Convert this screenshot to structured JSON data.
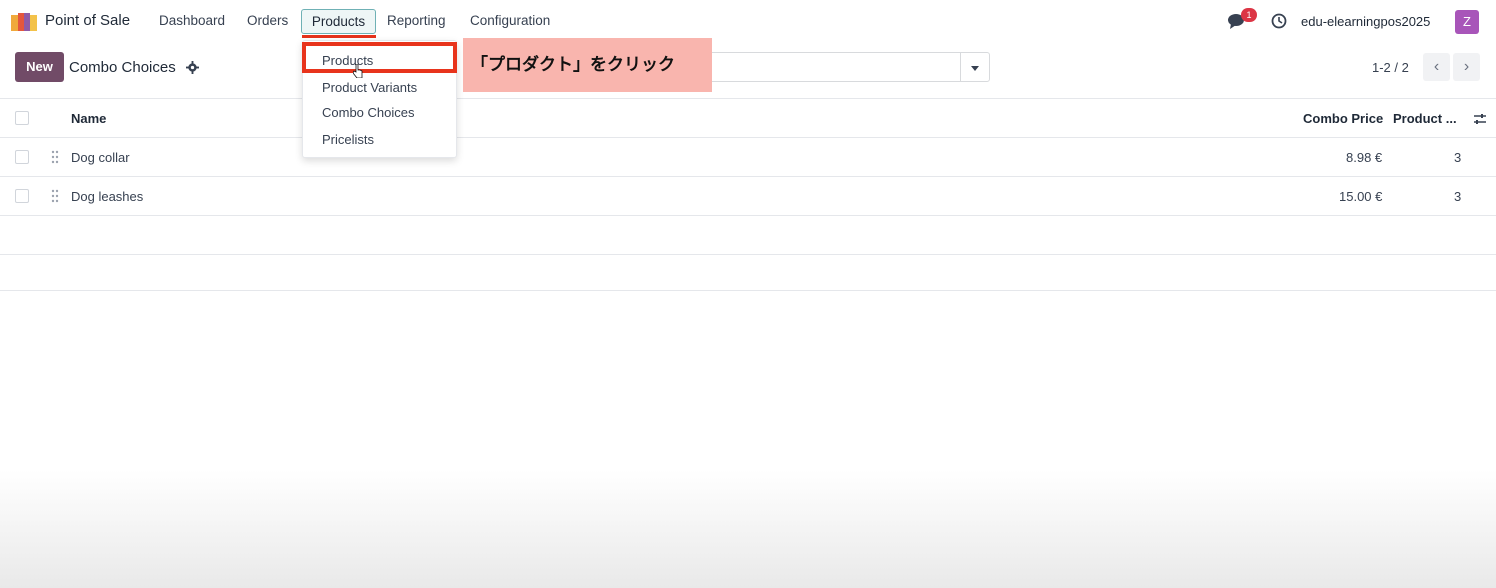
{
  "nav": {
    "app_name": "Point of Sale",
    "menu": [
      "Dashboard",
      "Orders",
      "Products",
      "Reporting",
      "Configuration"
    ],
    "notification_count": "1",
    "username": "edu-elearningpos2025",
    "avatar_letter": "Z"
  },
  "control_panel": {
    "new_label": "New",
    "title": "Combo Choices",
    "pager": "1-2 / 2"
  },
  "table": {
    "headers": [
      "Name",
      "Combo Price",
      "Product ..."
    ],
    "rows": [
      {
        "name": "Dog collar",
        "price": "8.98 €",
        "count": "3"
      },
      {
        "name": "Dog leashes",
        "price": "15.00 €",
        "count": "3"
      }
    ]
  },
  "dropdown": {
    "items": [
      "Products",
      "Product Variants",
      "Combo Choices",
      "Pricelists"
    ]
  },
  "annotation": {
    "text": "「プロダクト」をクリック"
  },
  "colors": {
    "brand": "#714b67",
    "highlight": "#e8341c",
    "callout_bg": "#f9b5ae",
    "avatar": "#a855b9"
  }
}
